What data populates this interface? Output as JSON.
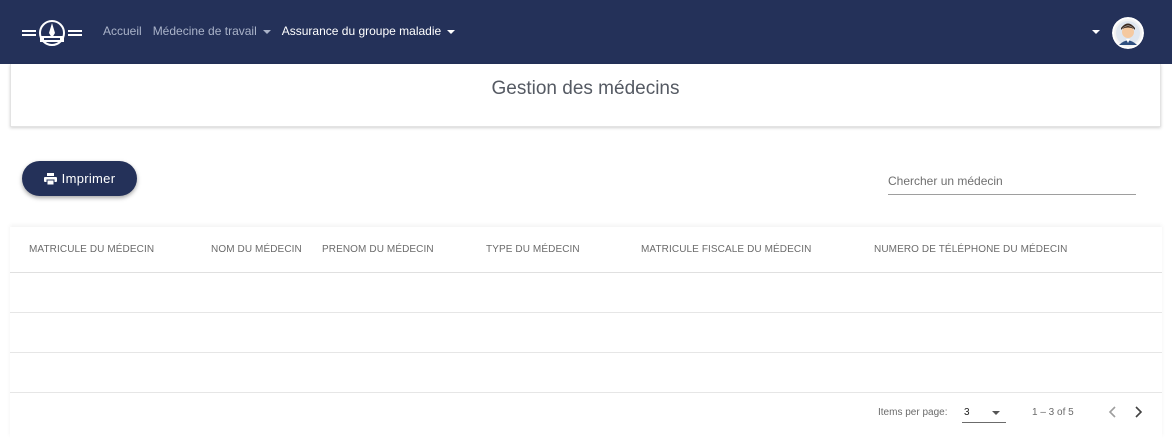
{
  "colors": {
    "navbar": "#243159",
    "accent": "#243159",
    "background": "#ffffff"
  },
  "nav": {
    "logo_icon": "brand-logo-icon",
    "links": [
      {
        "label": "Accueil",
        "dropdown": false,
        "active": false
      },
      {
        "label": "Médecine de travail",
        "dropdown": true,
        "active": false
      },
      {
        "label": "Assurance du groupe maladie",
        "dropdown": true,
        "active": true
      }
    ],
    "user_menu_icon": "chevron-down-icon",
    "avatar_icon": "user-avatar-icon"
  },
  "page": {
    "title": "Gestion des médecins"
  },
  "toolbar": {
    "print_label": "Imprimer",
    "print_icon": "printer-icon"
  },
  "search": {
    "placeholder": "Chercher un médecin",
    "value": ""
  },
  "table": {
    "columns": [
      "MATRICULE DU MÉDECIN",
      "NOM DU MÉDECIN",
      "PRENOM DU MÉDECIN",
      "TYPE DU MÉDECIN",
      "MATRICULE FISCALE DU MÉDECIN",
      "NUMERO DE TÉLÉPHONE DU MÉDECIN"
    ],
    "rows": [
      [
        "",
        "",
        "",
        "",
        "",
        ""
      ],
      [
        "",
        "",
        "",
        "",
        "",
        ""
      ],
      [
        "",
        "",
        "",
        "",
        "",
        ""
      ]
    ]
  },
  "paginator": {
    "items_per_page_label": "Items per page:",
    "items_per_page": "3",
    "range_label": "1 – 3 of 5"
  }
}
